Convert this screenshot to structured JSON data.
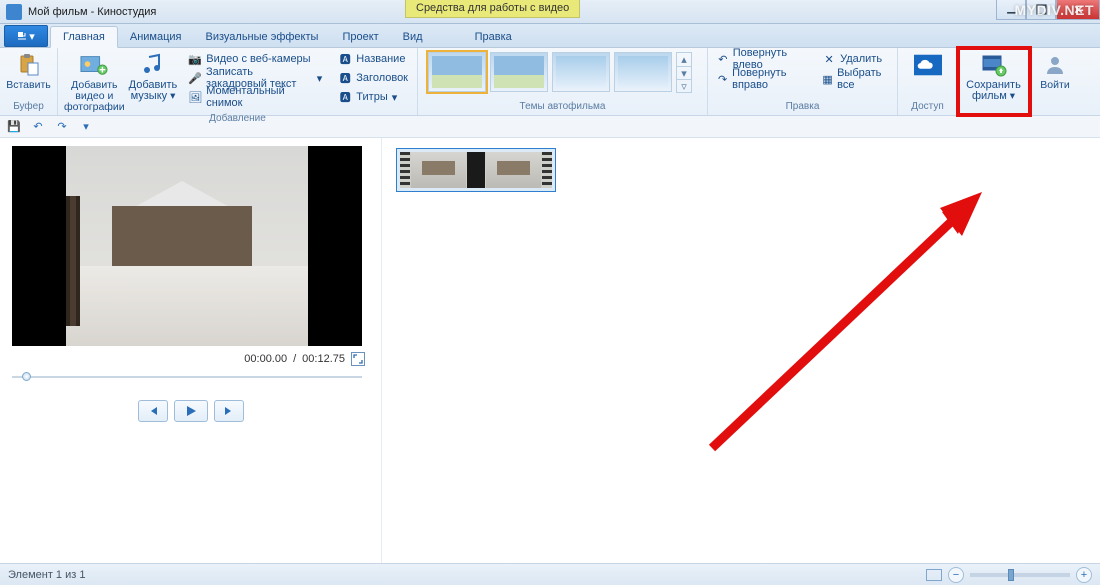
{
  "window": {
    "title": "Мой фильм - Киностудия",
    "contextual_tab": "Средства для работы с видео",
    "watermark": "MYDIV.NET"
  },
  "tabs": {
    "main": "Главная",
    "animation": "Анимация",
    "effects": "Визуальные эффекты",
    "project": "Проект",
    "view": "Вид",
    "edit": "Правка"
  },
  "ribbon": {
    "clipboard": {
      "paste": "Вставить",
      "group": "Буфер"
    },
    "add": {
      "add_video": "Добавить видео и фотографии",
      "add_music": "Добавить музыку",
      "webcam": "Видео с веб-камеры",
      "narration": "Записать закадровый текст",
      "snapshot": "Моментальный снимок",
      "title": "Название",
      "caption": "Заголовок",
      "credits": "Титры",
      "group": "Добавление"
    },
    "themes": {
      "group": "Темы автофильма"
    },
    "editing": {
      "rotate_left": "Повернуть влево",
      "rotate_right": "Повернуть вправо",
      "delete": "Удалить",
      "select_all": "Выбрать все",
      "group": "Правка"
    },
    "share": {
      "group": "Доступ"
    },
    "save": {
      "label": "Сохранить фильм"
    },
    "signin": {
      "label": "Войти"
    }
  },
  "player": {
    "time_current": "00:00.00",
    "time_total": "00:12.75"
  },
  "status": {
    "text": "Элемент 1 из 1"
  }
}
